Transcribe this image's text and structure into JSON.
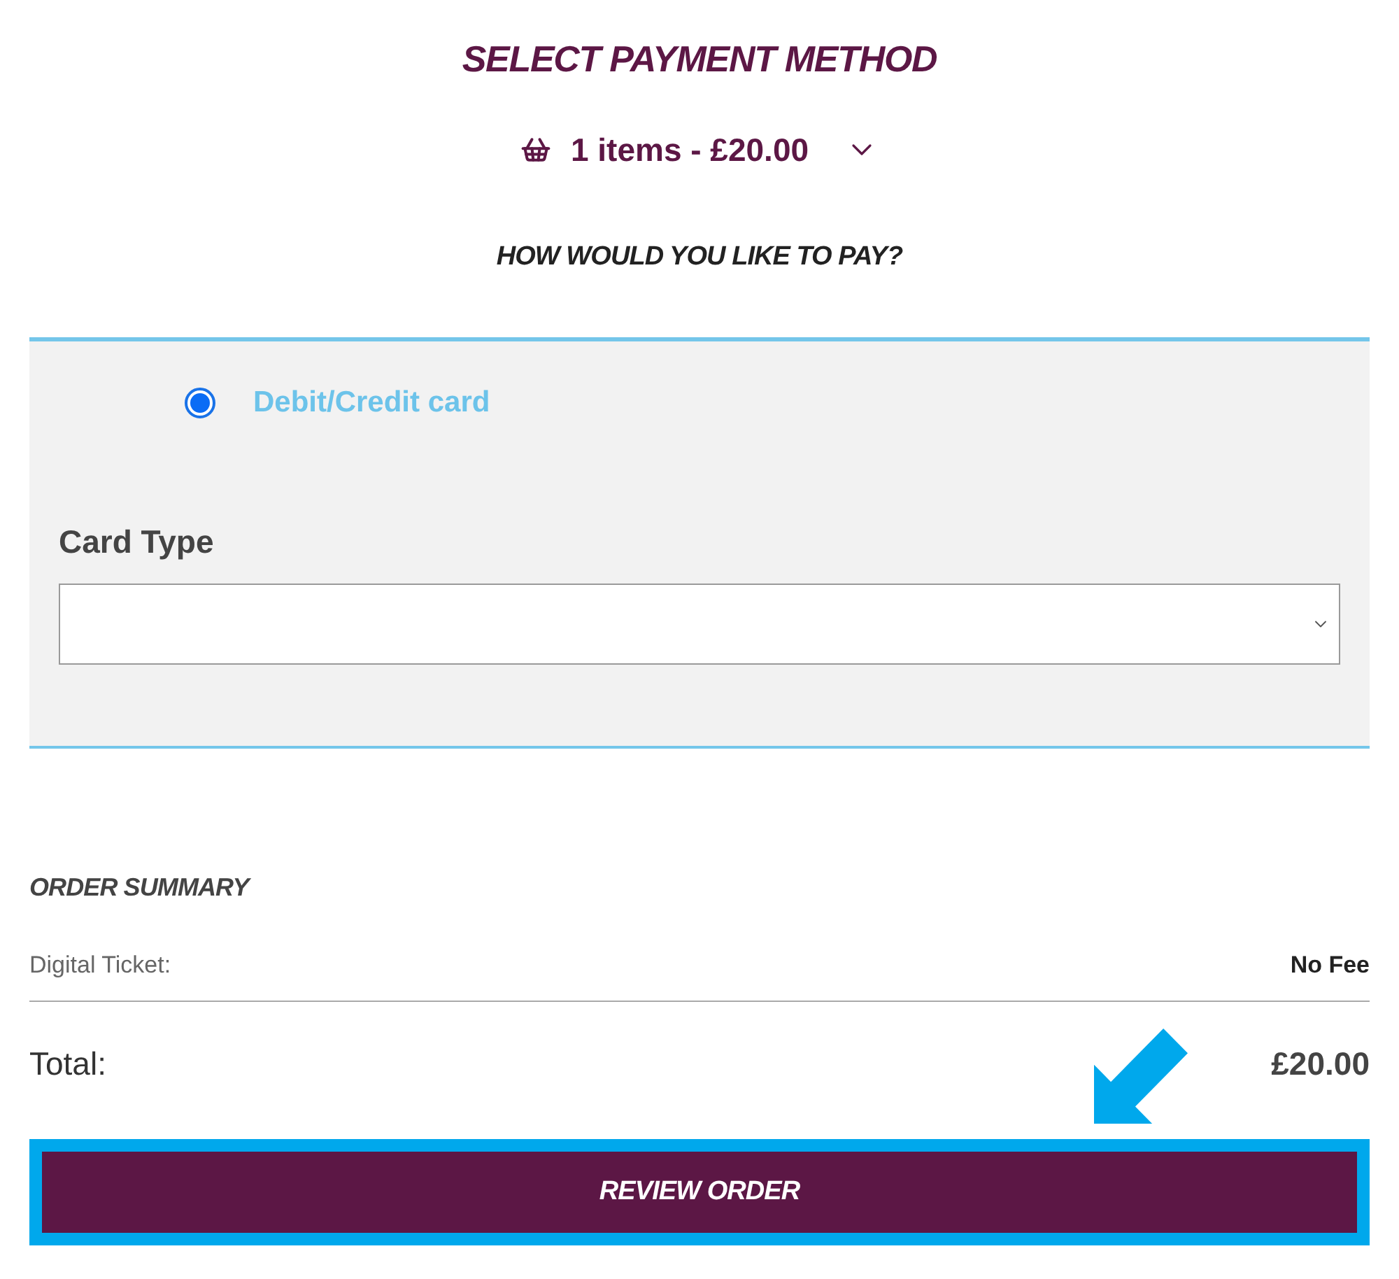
{
  "header": {
    "title": "SELECT PAYMENT METHOD",
    "basket_summary": "1 items - £20.00",
    "expanded": false
  },
  "prompt": "HOW WOULD YOU LIKE TO PAY?",
  "payment_methods": [
    {
      "label": "Debit/Credit card",
      "selected": true
    }
  ],
  "card_type": {
    "label": "Card Type"
  },
  "order_summary": {
    "title": "ORDER SUMMARY",
    "rows": [
      {
        "label": "Digital Ticket:",
        "value": "No Fee"
      }
    ],
    "total": {
      "label": "Total:",
      "value": "£20.00"
    }
  },
  "review_button": {
    "label": "REVIEW ORDER",
    "focused": true
  }
}
